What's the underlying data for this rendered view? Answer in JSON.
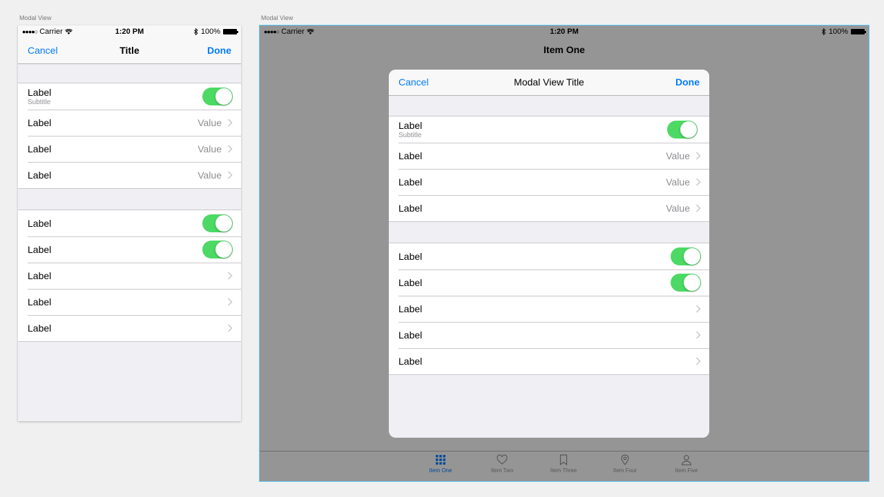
{
  "phone": {
    "artboard_title": "Modal View",
    "status_bar": {
      "carrier": "Carrier",
      "time": "1:20 PM",
      "battery": "100%",
      "signal_dots": "●●●●○"
    },
    "nav": {
      "left": "Cancel",
      "title": "Title",
      "right": "Done"
    },
    "group1": [
      {
        "label": "Label",
        "subtitle": "Subtitle",
        "toggle": true
      },
      {
        "label": "Label",
        "value": "Value"
      },
      {
        "label": "Label",
        "value": "Value"
      },
      {
        "label": "Label",
        "value": "Value"
      }
    ],
    "group2": [
      {
        "label": "Label",
        "toggle": true
      },
      {
        "label": "Label",
        "toggle": true
      },
      {
        "label": "Label"
      },
      {
        "label": "Label"
      },
      {
        "label": "Label"
      }
    ]
  },
  "tablet": {
    "artboard_title": "Modal View",
    "status_bar": {
      "carrier": "Carrier",
      "time": "1:20 PM",
      "battery": "100%",
      "signal_dots": "●●●●○"
    },
    "background_title": "Item One",
    "modal": {
      "nav": {
        "left": "Cancel",
        "title": "Modal View Title",
        "right": "Done"
      },
      "group1": [
        {
          "label": "Label",
          "subtitle": "Subtitle",
          "toggle": true
        },
        {
          "label": "Label",
          "value": "Value"
        },
        {
          "label": "Label",
          "value": "Value"
        },
        {
          "label": "Label",
          "value": "Value"
        }
      ],
      "group2": [
        {
          "label": "Label",
          "toggle": true
        },
        {
          "label": "Label",
          "toggle": true
        },
        {
          "label": "Label"
        },
        {
          "label": "Label"
        },
        {
          "label": "Label"
        }
      ]
    },
    "tabs": [
      {
        "label": "Item One",
        "icon": "grid-icon",
        "active": true
      },
      {
        "label": "Item Two",
        "icon": "heart-icon",
        "active": false
      },
      {
        "label": "Item Three",
        "icon": "bookmark-icon",
        "active": false
      },
      {
        "label": "Item Four",
        "icon": "map-pin-icon",
        "active": false
      },
      {
        "label": "Item Five",
        "icon": "person-icon",
        "active": false
      }
    ]
  },
  "colors": {
    "tint": "#007aff",
    "switch_on": "#4cd964",
    "separator": "#c8c7cc",
    "group_background": "#efeff4",
    "secondary_text": "#8e8e93",
    "selection_border": "#5ac8fa"
  }
}
